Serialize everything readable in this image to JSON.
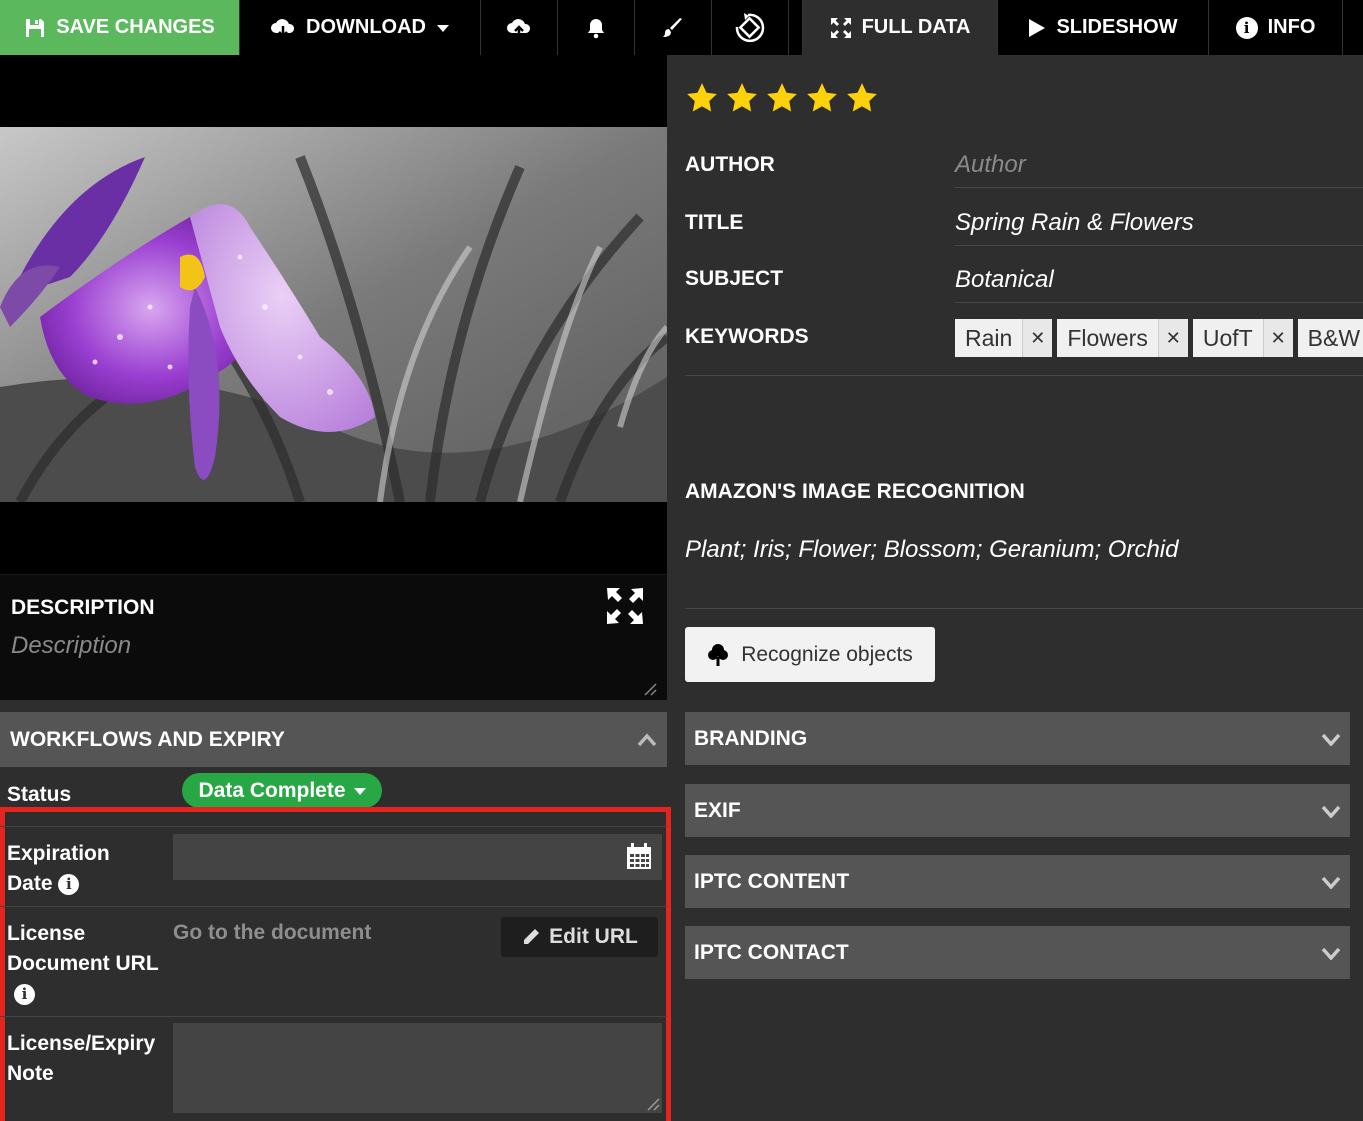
{
  "toolbar": {
    "save_label": "SAVE CHANGES",
    "download_label": "DOWNLOAD",
    "full_data_label": "FULL DATA",
    "slideshow_label": "SLIDESHOW",
    "info_label": "INFO"
  },
  "description": {
    "title": "DESCRIPTION",
    "placeholder": "Description"
  },
  "workflows": {
    "title": "WORKFLOWS AND EXPIRY",
    "status_label": "Status",
    "status_value": "Data Complete",
    "expiration_label_1": "Expiration",
    "expiration_label_2": "Date",
    "license_label_1": "License",
    "license_label_2": "Document URL",
    "license_link": "Go to the document",
    "edit_url_label": "Edit URL",
    "note_label_1": "License/Expiry",
    "note_label_2": "Note"
  },
  "metadata": {
    "rating": 5,
    "author_label": "AUTHOR",
    "author_placeholder": "Author",
    "title_label": "TITLE",
    "title_value": "Spring Rain & Flowers",
    "subject_label": "SUBJECT",
    "subject_value": "Botanical",
    "keywords_label": "KEYWORDS",
    "keywords": [
      "Rain",
      "Flowers",
      "UofT",
      "B&W"
    ]
  },
  "recognition": {
    "title": "AMAZON'S IMAGE RECOGNITION",
    "labels": "Plant; Iris; Flower; Blossom; Geranium; Orchid",
    "button_label": "Recognize objects"
  },
  "panels": [
    "BRANDING",
    "EXIF",
    "IPTC CONTENT",
    "IPTC CONTACT"
  ],
  "colors": {
    "save": "#5cb85c",
    "status": "#28a745",
    "highlight": "#e52420",
    "star": "#fdd20b"
  }
}
